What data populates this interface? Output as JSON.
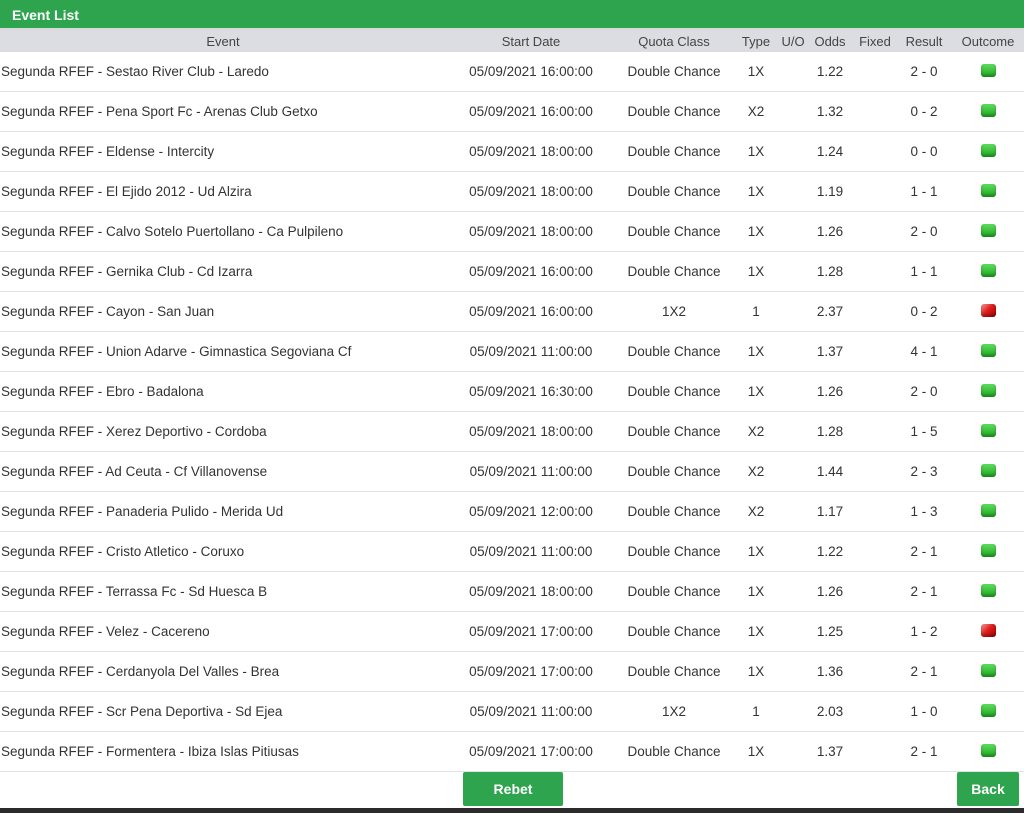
{
  "title": "Event List",
  "columns": {
    "event": "Event",
    "start_date": "Start Date",
    "quota_class": "Quota Class",
    "type": "Type",
    "uo": "U/O",
    "odds": "Odds",
    "fixed": "Fixed",
    "result": "Result",
    "outcome": "Outcome"
  },
  "rows": [
    {
      "event": "Segunda RFEF - Sestao River Club - Laredo",
      "start": "05/09/2021 16:00:00",
      "quota": "Double Chance",
      "type": "1X",
      "uo": "",
      "odds": "1.22",
      "fixed": "",
      "result": "2 - 0",
      "outcome": "win"
    },
    {
      "event": "Segunda RFEF - Pena Sport Fc - Arenas Club Getxo",
      "start": "05/09/2021 16:00:00",
      "quota": "Double Chance",
      "type": "X2",
      "uo": "",
      "odds": "1.32",
      "fixed": "",
      "result": "0 - 2",
      "outcome": "win"
    },
    {
      "event": "Segunda RFEF - Eldense - Intercity",
      "start": "05/09/2021 18:00:00",
      "quota": "Double Chance",
      "type": "1X",
      "uo": "",
      "odds": "1.24",
      "fixed": "",
      "result": "0 - 0",
      "outcome": "win"
    },
    {
      "event": "Segunda RFEF - El Ejido 2012 - Ud Alzira",
      "start": "05/09/2021 18:00:00",
      "quota": "Double Chance",
      "type": "1X",
      "uo": "",
      "odds": "1.19",
      "fixed": "",
      "result": "1 - 1",
      "outcome": "win"
    },
    {
      "event": "Segunda RFEF - Calvo Sotelo Puertollano - Ca Pulpileno",
      "start": "05/09/2021 18:00:00",
      "quota": "Double Chance",
      "type": "1X",
      "uo": "",
      "odds": "1.26",
      "fixed": "",
      "result": "2 - 0",
      "outcome": "win"
    },
    {
      "event": "Segunda RFEF - Gernika Club - Cd Izarra",
      "start": "05/09/2021 16:00:00",
      "quota": "Double Chance",
      "type": "1X",
      "uo": "",
      "odds": "1.28",
      "fixed": "",
      "result": "1 - 1",
      "outcome": "win"
    },
    {
      "event": "Segunda RFEF - Cayon - San Juan",
      "start": "05/09/2021 16:00:00",
      "quota": "1X2",
      "type": "1",
      "uo": "",
      "odds": "2.37",
      "fixed": "",
      "result": "0 - 2",
      "outcome": "lose"
    },
    {
      "event": "Segunda RFEF - Union Adarve - Gimnastica Segoviana Cf",
      "start": "05/09/2021 11:00:00",
      "quota": "Double Chance",
      "type": "1X",
      "uo": "",
      "odds": "1.37",
      "fixed": "",
      "result": "4 - 1",
      "outcome": "win"
    },
    {
      "event": "Segunda RFEF - Ebro - Badalona",
      "start": "05/09/2021 16:30:00",
      "quota": "Double Chance",
      "type": "1X",
      "uo": "",
      "odds": "1.26",
      "fixed": "",
      "result": "2 - 0",
      "outcome": "win"
    },
    {
      "event": "Segunda RFEF - Xerez Deportivo - Cordoba",
      "start": "05/09/2021 18:00:00",
      "quota": "Double Chance",
      "type": "X2",
      "uo": "",
      "odds": "1.28",
      "fixed": "",
      "result": "1 - 5",
      "outcome": "win"
    },
    {
      "event": "Segunda RFEF - Ad Ceuta - Cf Villanovense",
      "start": "05/09/2021 11:00:00",
      "quota": "Double Chance",
      "type": "X2",
      "uo": "",
      "odds": "1.44",
      "fixed": "",
      "result": "2 - 3",
      "outcome": "win"
    },
    {
      "event": "Segunda RFEF - Panaderia Pulido - Merida Ud",
      "start": "05/09/2021 12:00:00",
      "quota": "Double Chance",
      "type": "X2",
      "uo": "",
      "odds": "1.17",
      "fixed": "",
      "result": "1 - 3",
      "outcome": "win"
    },
    {
      "event": "Segunda RFEF - Cristo Atletico - Coruxo",
      "start": "05/09/2021 11:00:00",
      "quota": "Double Chance",
      "type": "1X",
      "uo": "",
      "odds": "1.22",
      "fixed": "",
      "result": "2 - 1",
      "outcome": "win"
    },
    {
      "event": "Segunda RFEF - Terrassa Fc - Sd Huesca B",
      "start": "05/09/2021 18:00:00",
      "quota": "Double Chance",
      "type": "1X",
      "uo": "",
      "odds": "1.26",
      "fixed": "",
      "result": "2 - 1",
      "outcome": "win"
    },
    {
      "event": "Segunda RFEF - Velez - Cacereno",
      "start": "05/09/2021 17:00:00",
      "quota": "Double Chance",
      "type": "1X",
      "uo": "",
      "odds": "1.25",
      "fixed": "",
      "result": "1 - 2",
      "outcome": "lose"
    },
    {
      "event": "Segunda RFEF - Cerdanyola Del Valles - Brea",
      "start": "05/09/2021 17:00:00",
      "quota": "Double Chance",
      "type": "1X",
      "uo": "",
      "odds": "1.36",
      "fixed": "",
      "result": "2 - 1",
      "outcome": "win"
    },
    {
      "event": "Segunda RFEF - Scr Pena Deportiva - Sd Ejea",
      "start": "05/09/2021 11:00:00",
      "quota": "1X2",
      "type": "1",
      "uo": "",
      "odds": "2.03",
      "fixed": "",
      "result": "1 - 0",
      "outcome": "win"
    },
    {
      "event": "Segunda RFEF - Formentera - Ibiza Islas Pitiusas",
      "start": "05/09/2021 17:00:00",
      "quota": "Double Chance",
      "type": "1X",
      "uo": "",
      "odds": "1.37",
      "fixed": "",
      "result": "2 - 1",
      "outcome": "win"
    }
  ],
  "buttons": {
    "rebet": "Rebet",
    "back": "Back"
  },
  "colors": {
    "brand_green": "#2ea44f",
    "header_gray": "#dcdde2",
    "win": "#2cc42c",
    "lose": "#e02020"
  },
  "icons": {
    "win": "green-win-icon",
    "lose": "red-loss-icon"
  }
}
